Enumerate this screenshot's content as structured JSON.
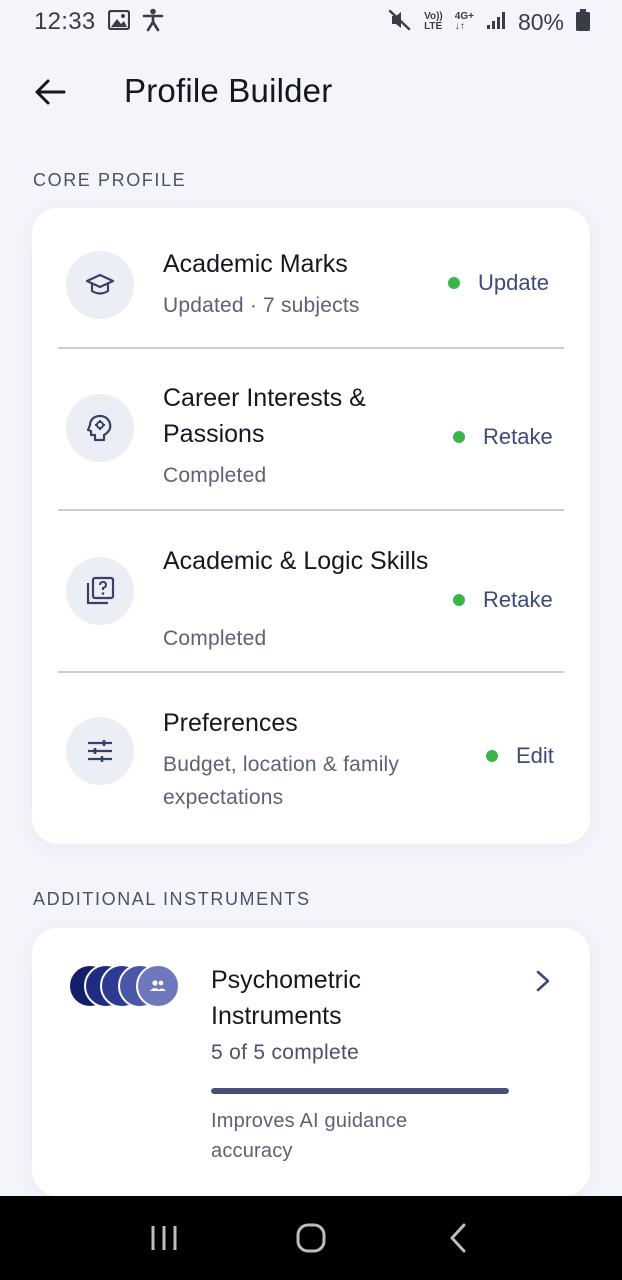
{
  "status_bar": {
    "time": "12:33",
    "volte_top": "Vo))",
    "volte_bottom": "LTE",
    "network_top": "4G+",
    "network_bottom": "↓↑",
    "battery": "80%"
  },
  "header": {
    "title": "Profile Builder"
  },
  "core_profile": {
    "section_label": "CORE PROFILE",
    "items": [
      {
        "title": "Academic Marks",
        "subtitle": "Updated · 7 subjects",
        "action": "Update",
        "icon": "graduation-cap-icon",
        "status_color": "#3bb54a"
      },
      {
        "title": "Career Interests & Passions",
        "subtitle": "Completed",
        "action": "Retake",
        "icon": "head-gear-icon",
        "status_color": "#3bb54a"
      },
      {
        "title": "Academic & Logic Skills",
        "subtitle": "Completed",
        "action": "Retake",
        "icon": "quiz-icon",
        "status_color": "#3bb54a"
      },
      {
        "title": "Preferences",
        "subtitle": "Budget, location & family expectations",
        "action": "Edit",
        "icon": "sliders-icon",
        "status_color": "#3bb54a"
      }
    ]
  },
  "additional": {
    "section_label": "ADDITIONAL INSTRUMENTS",
    "instrument": {
      "title": "Psychometric Instruments",
      "progress_text": "5 of 5 complete",
      "progress_fraction": 1.0,
      "note": "Improves AI guidance accuracy"
    }
  },
  "colors": {
    "accent": "#3e4a78",
    "progress": "#48507a",
    "status_green": "#3bb54a"
  }
}
